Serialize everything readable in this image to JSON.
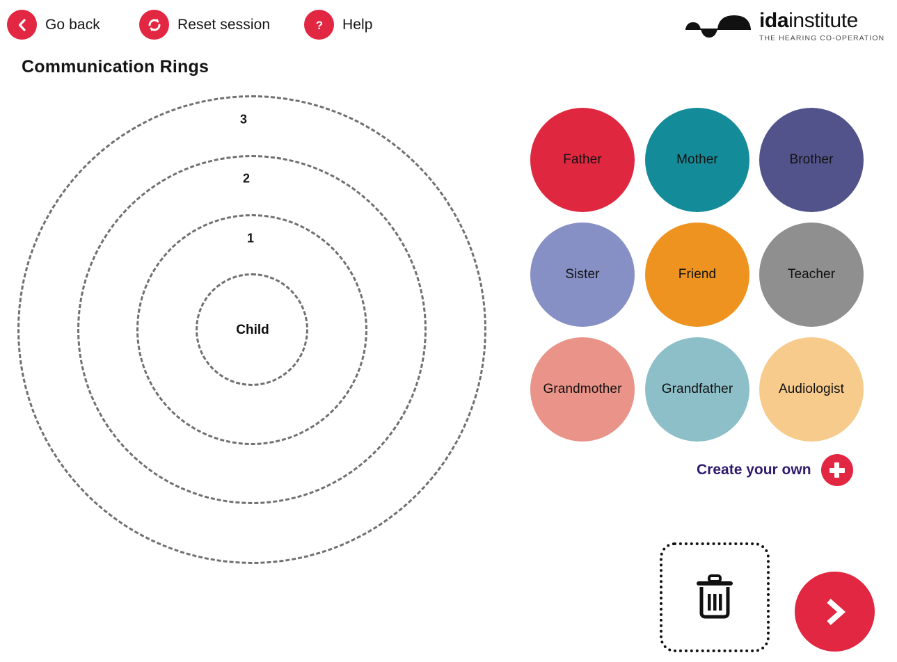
{
  "toolbar": {
    "go_back": {
      "label": "Go back",
      "icon": "chevron-left-icon"
    },
    "reset_session": {
      "label": "Reset session",
      "icon": "refresh-icon"
    },
    "help": {
      "label": "Help",
      "icon": "question-mark-icon"
    },
    "accent_color": "#E12741"
  },
  "logo": {
    "word_bold": "ida",
    "word_light": "institute",
    "tagline": "THE HEARING CO-OPERATION"
  },
  "page": {
    "title": "Communication Rings"
  },
  "rings": {
    "center_label": "Child",
    "labels": [
      "1",
      "2",
      "3"
    ],
    "stroke_color": "#6f7073",
    "ring_radii": [
      81,
      166,
      251,
      337
    ]
  },
  "palette": {
    "items": [
      {
        "label": "Father",
        "color": "#E02740"
      },
      {
        "label": "Mother",
        "color": "#148B99"
      },
      {
        "label": "Brother",
        "color": "#53538B"
      },
      {
        "label": "Sister",
        "color": "#8690C4"
      },
      {
        "label": "Friend",
        "color": "#EF9320"
      },
      {
        "label": "Teacher",
        "color": "#8F8F8F"
      },
      {
        "label": "Grandmother",
        "color": "#EA9389"
      },
      {
        "label": "Grandfather",
        "color": "#8DBFC9"
      },
      {
        "label": "Audiologist",
        "color": "#F7CB8C"
      }
    ]
  },
  "create_own": {
    "label": "Create your own",
    "icon": "plus-icon",
    "text_color": "#30196E"
  },
  "bottom_controls": {
    "trash": {
      "icon": "trash-icon"
    },
    "next": {
      "icon": "chevron-right-icon",
      "color": "#E12741"
    }
  }
}
